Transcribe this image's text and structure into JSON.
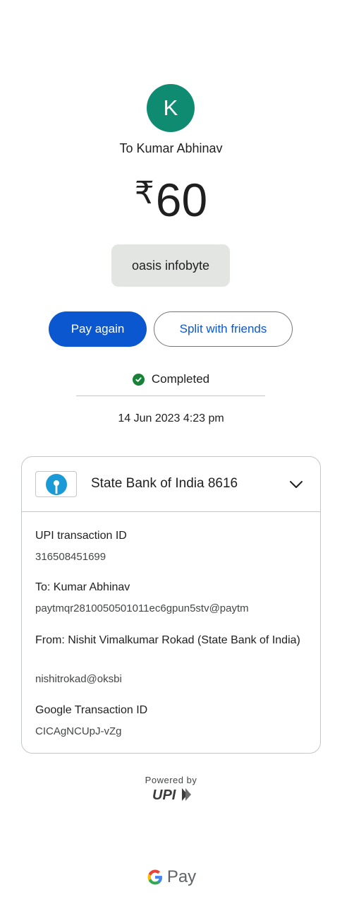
{
  "avatar": {
    "letter": "K",
    "color": "#0f8b72"
  },
  "recipient_line": "To Kumar Abhinav",
  "amount": {
    "currency": "₹",
    "value": "60"
  },
  "note": "oasis infobyte",
  "actions": {
    "pay_again": "Pay again",
    "split": "Split with friends"
  },
  "status": {
    "text": "Completed",
    "color": "#188038"
  },
  "datetime": "14 Jun 2023 4:23 pm",
  "bank": {
    "name": "State Bank of India 8616",
    "logo_icon": "sbi-logo-icon",
    "expand_icon": "chevron-down-icon"
  },
  "details": {
    "upi_id_label": "UPI transaction ID",
    "upi_id_value": "316508451699",
    "to_label": "To: Kumar Abhinav",
    "to_value": "paytmqr2810050501011ec6gpun5stv@paytm",
    "from_label": "From: Nishit Vimalkumar Rokad (State Bank of India)",
    "from_value": "nishitrokad@oksbi",
    "google_id_label": "Google Transaction ID",
    "google_id_value": "CICAgNCUpJ-vZg"
  },
  "footer": {
    "powered_by": "Powered by",
    "upi_logo_text": "UPI",
    "gpay_text": "Pay"
  },
  "colors": {
    "primary": "#0b57d0",
    "border": "#c4c7c5"
  }
}
